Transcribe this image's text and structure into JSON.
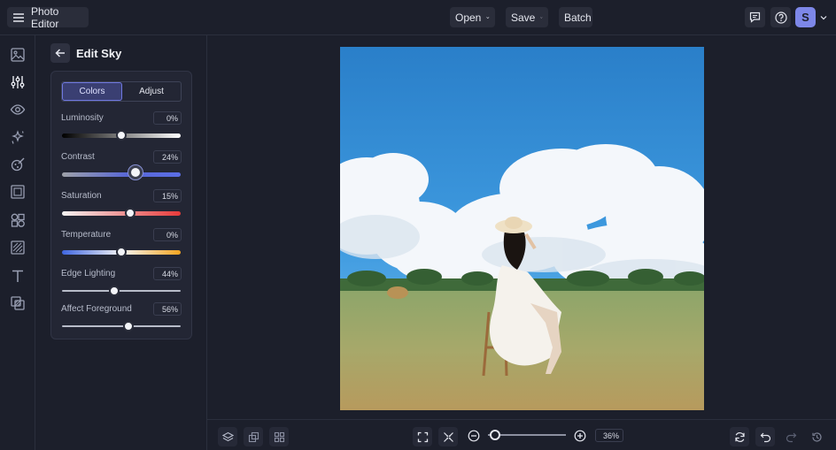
{
  "app": {
    "title": "Photo Editor",
    "user_initial": "S"
  },
  "menu": {
    "open": "Open",
    "save": "Save",
    "batch": "Batch"
  },
  "panel": {
    "title": "Edit Sky",
    "tabs": [
      {
        "label": "Colors",
        "active": true
      },
      {
        "label": "Adjust",
        "active": false
      }
    ],
    "controls": [
      {
        "label": "Luminosity",
        "value": "0%",
        "level": 0
      },
      {
        "label": "Contrast",
        "value": "24%",
        "level": 24
      },
      {
        "label": "Saturation",
        "value": "15%",
        "level": 15
      },
      {
        "label": "Temperature",
        "value": "0%",
        "level": 0
      },
      {
        "label": "Edge Lighting",
        "value": "44%",
        "level": 44
      },
      {
        "label": "Affect Foreground",
        "value": "56%",
        "level": 56
      }
    ]
  },
  "zoom": {
    "value": "36%"
  },
  "colors": {
    "accent": "#6f78e0",
    "avatar": "#7d87e8",
    "background": "#1c1f2b"
  }
}
